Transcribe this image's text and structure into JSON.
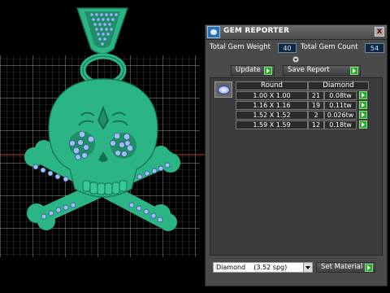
{
  "panel": {
    "title": "GEM REPORTER",
    "close_glyph": "x",
    "logo_icon": "gem-reporter-logo-icon"
  },
  "stats": {
    "weight_label": "Total Gem Weight",
    "weight_value": "40",
    "count_label": "Total Gem Count",
    "count_value": "54"
  },
  "buttons": {
    "update_label": "Update",
    "save_report_label": "Save Report",
    "set_material_label": "Set Material"
  },
  "table": {
    "shape_header": "Round",
    "material_header": "Diamond",
    "rows": [
      {
        "size": "1.00 X 1.00",
        "count": "21",
        "weight": "0.08tw"
      },
      {
        "size": "1.16 X 1.16",
        "count": "19",
        "weight": "0.11tw"
      },
      {
        "size": "1.52 X 1.52",
        "count": "2",
        "weight": "0.026tw"
      },
      {
        "size": "1.59 X 1.59",
        "count": "12",
        "weight": "0.18tw"
      }
    ]
  },
  "material": {
    "selected": "Diamond    (3.52 spg)"
  },
  "colors": {
    "model_green": "#2bb585",
    "gem_blue": "#8fb8f0",
    "go_green": "#2fa62f",
    "panel_bg": "#4a4a4a"
  }
}
